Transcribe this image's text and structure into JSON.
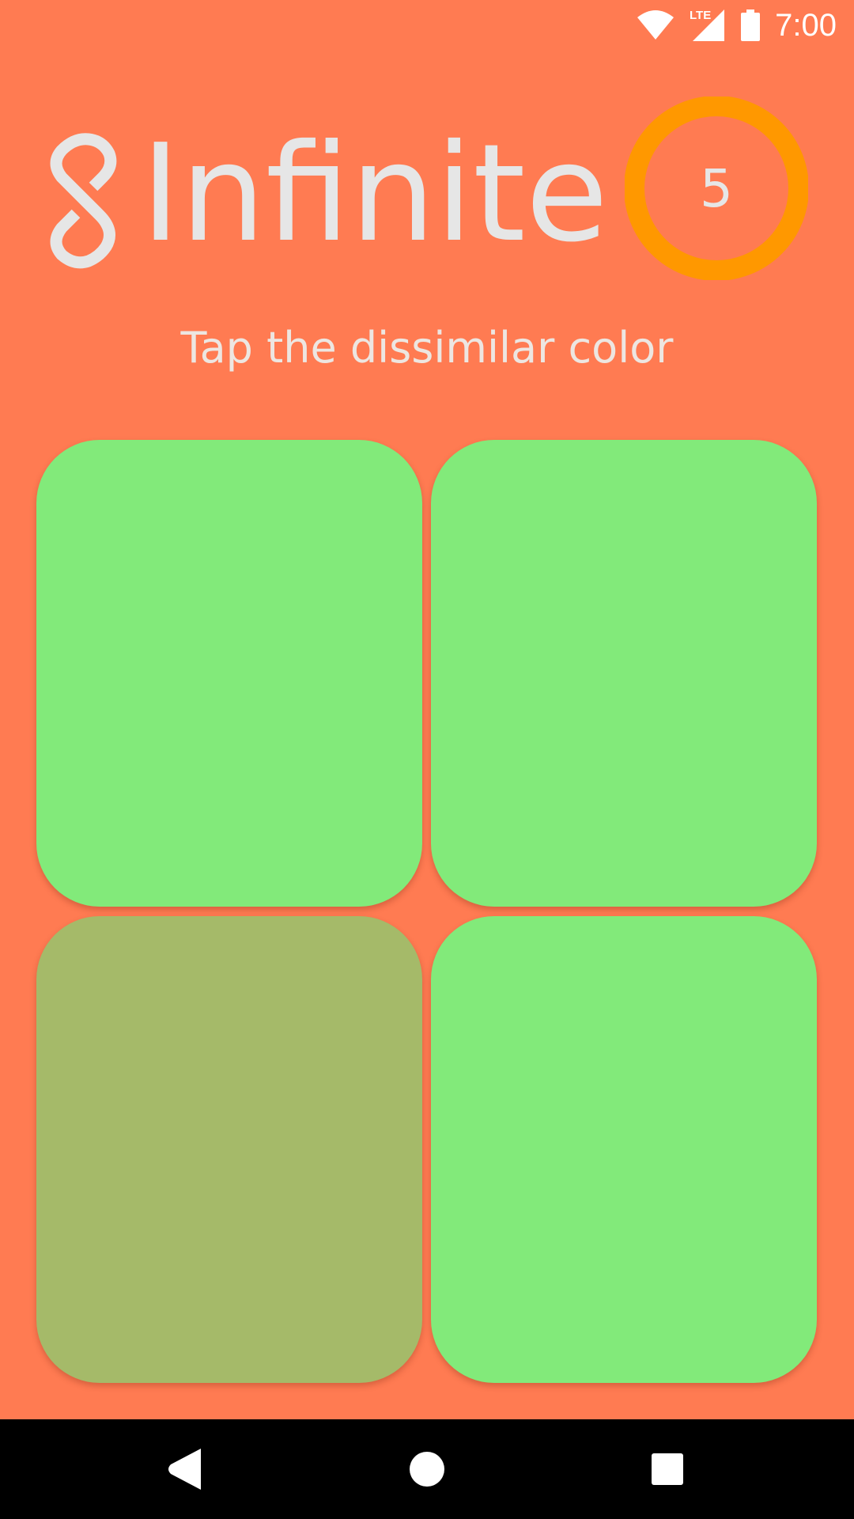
{
  "status_bar": {
    "time": "7:00",
    "network_label": "LTE",
    "icons": [
      "wifi-icon",
      "cellular-signal-icon",
      "battery-icon"
    ]
  },
  "header": {
    "mode_icon": "infinity-icon",
    "title": "Infinite",
    "timer": {
      "value": "5",
      "ring_color": "#FF9800"
    }
  },
  "instruction": "Tap the dissimilar color",
  "grid": {
    "rows": 2,
    "columns": 2,
    "tiles": [
      {
        "color": "#82EA7A",
        "odd": false
      },
      {
        "color": "#82EA7A",
        "odd": false
      },
      {
        "color": "#A5BA69",
        "odd": true
      },
      {
        "color": "#82EA7A",
        "odd": false
      }
    ]
  },
  "nav_bar": {
    "buttons": [
      "back-icon",
      "home-icon",
      "recents-icon"
    ]
  },
  "colors": {
    "background": "#FF7B52",
    "text_light": "#E6E6E6",
    "nav_bar": "#000000"
  }
}
